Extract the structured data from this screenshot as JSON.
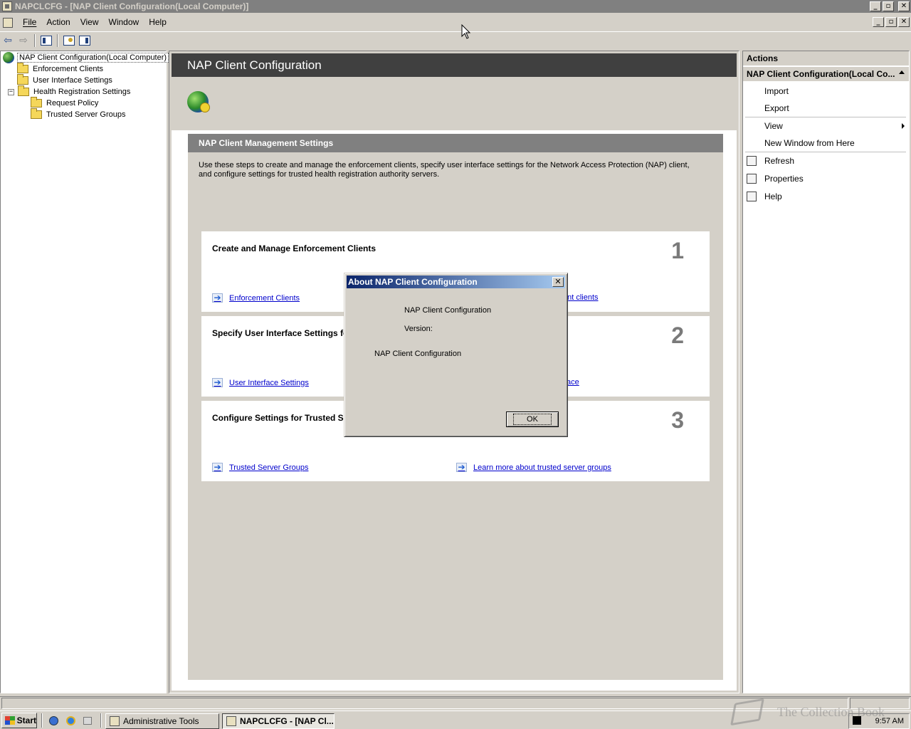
{
  "window": {
    "title": "NAPCLCFG - [NAP Client Configuration(Local Computer)]",
    "buttons": {
      "minimize": "_",
      "maximize": "▫",
      "close": "✕"
    }
  },
  "menu": {
    "items": [
      "File",
      "Action",
      "View",
      "Window",
      "Help"
    ]
  },
  "toolbar": {
    "back_icon": "back-arrow-icon",
    "forward_icon": "forward-arrow-icon",
    "show_hide_tree_icon": "console-tree-icon",
    "help_icon": "help-icon",
    "show_hide_action_icon": "action-pane-icon"
  },
  "tree": {
    "root": "NAP Client Configuration(Local Computer)",
    "items": [
      {
        "label": "Enforcement Clients"
      },
      {
        "label": "User Interface Settings"
      },
      {
        "label": "Health Registration Settings",
        "expander": "−"
      },
      {
        "label": "Request Policy"
      },
      {
        "label": "Trusted Server Groups"
      }
    ]
  },
  "main": {
    "header_title": "NAP Client Configuration",
    "panel_title": "NAP Client Management Settings",
    "panel_description": "Use these steps to create and manage the enforcement clients, specify user interface settings for the Network Access Protection (NAP) client, and configure settings for trusted health registration authority servers.",
    "cards": [
      {
        "title": "Create and Manage Enforcement Clients",
        "number": "1",
        "link_left": "Enforcement Clients",
        "link_right": "ent clients"
      },
      {
        "title": "Specify User Interface Settings fo",
        "number": "2",
        "link_left": "User Interface Settings",
        "link_right": "ace"
      },
      {
        "title": "Configure Settings for Trusted Se",
        "number": "3",
        "link_left": "Trusted Server Groups",
        "link_right": "Learn more about trusted server groups"
      }
    ],
    "link_arrow": "➔"
  },
  "actions": {
    "title": "Actions",
    "section": "NAP Client Configuration(Local Co...",
    "items": [
      {
        "label": "Import"
      },
      {
        "label": "Export"
      },
      {
        "label": "View"
      },
      {
        "label": "New Window from Here"
      },
      {
        "label": "Refresh"
      },
      {
        "label": "Properties"
      },
      {
        "label": "Help"
      }
    ]
  },
  "dialog": {
    "title": "About NAP Client Configuration",
    "close": "✕",
    "product_name": "NAP Client Configuration",
    "version_label": "Version:",
    "description": "NAP Client Configuration",
    "ok_label": "OK"
  },
  "taskbar": {
    "start_label": "Start",
    "tasks": [
      {
        "label": "Administrative Tools"
      },
      {
        "label": "NAPCLCFG - [NAP Cl..."
      }
    ],
    "clock": "9:57 AM"
  },
  "watermark": "The Collection Book"
}
